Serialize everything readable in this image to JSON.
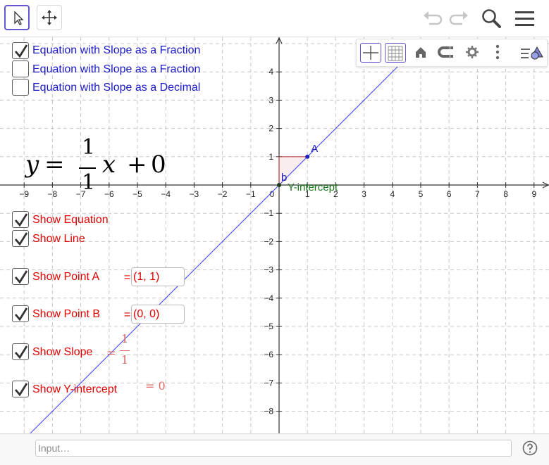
{
  "toolbar": {
    "tools": [
      {
        "name": "move-tool",
        "icon": "arrow-pointer-icon",
        "active": true
      },
      {
        "name": "pan-tool",
        "icon": "move-cross-icon",
        "active": false
      }
    ],
    "actions": [
      "undo-icon",
      "redo-icon",
      "search-icon",
      "menu-icon"
    ]
  },
  "style_bar": {
    "buttons": [
      "axes-icon",
      "grid-icon",
      "home-icon",
      "magnet-icon",
      "gear-icon",
      "more-vertical-icon",
      "toggle-stylebar-icon"
    ]
  },
  "checkboxes_top": [
    {
      "label": "Equation with Slope as a Fraction",
      "checked": true
    },
    {
      "label": "Equation with Slope as a Fraction",
      "checked": false
    },
    {
      "label": "Equation with Slope as a Decimal",
      "checked": false
    }
  ],
  "equation": {
    "lhs": "y",
    "eq": "=",
    "numerator": "1",
    "denominator": "1",
    "var": "x",
    "plus": "+",
    "intercept": "0"
  },
  "checkboxes_bottom": {
    "show_equation": {
      "label": "Show Equation",
      "checked": true
    },
    "show_line": {
      "label": "Show Line",
      "checked": true
    },
    "show_point_a": {
      "label": "Show Point A",
      "checked": true,
      "eq": "=",
      "value": "(1, 1)"
    },
    "show_point_b": {
      "label": "Show Point B",
      "checked": true,
      "eq": "=",
      "value": "(0, 0)"
    },
    "show_slope": {
      "label": "Show Slope",
      "checked": true,
      "eq": "=",
      "numerator": "1",
      "denominator": "1"
    },
    "show_y_intercept": {
      "label": "Show Y-intercept",
      "checked": true,
      "eq": "= 0"
    }
  },
  "graph": {
    "x_ticks": [
      "−9",
      "−8",
      "−7",
      "−6",
      "−5",
      "−4",
      "−3",
      "−2",
      "−1",
      "0",
      "1",
      "2",
      "3",
      "4",
      "5",
      "6",
      "7",
      "8",
      "9"
    ],
    "y_ticks_pos": [
      "1",
      "2",
      "3",
      "4"
    ],
    "y_ticks_neg": [
      "−1",
      "−2",
      "−3",
      "−4",
      "−5",
      "−6",
      "−7",
      "−8"
    ],
    "point_a_label": "A",
    "point_b_label": "b",
    "y_intercept_label": "Y-intercept",
    "line_color": "#3b3bff",
    "point_color": "#2020c0",
    "intercept_color": "#1a7a1a",
    "slope_triangle_color": "#c0504d"
  },
  "input_bar": {
    "placeholder": "Input…"
  },
  "help_icon": "help-circle-icon"
}
